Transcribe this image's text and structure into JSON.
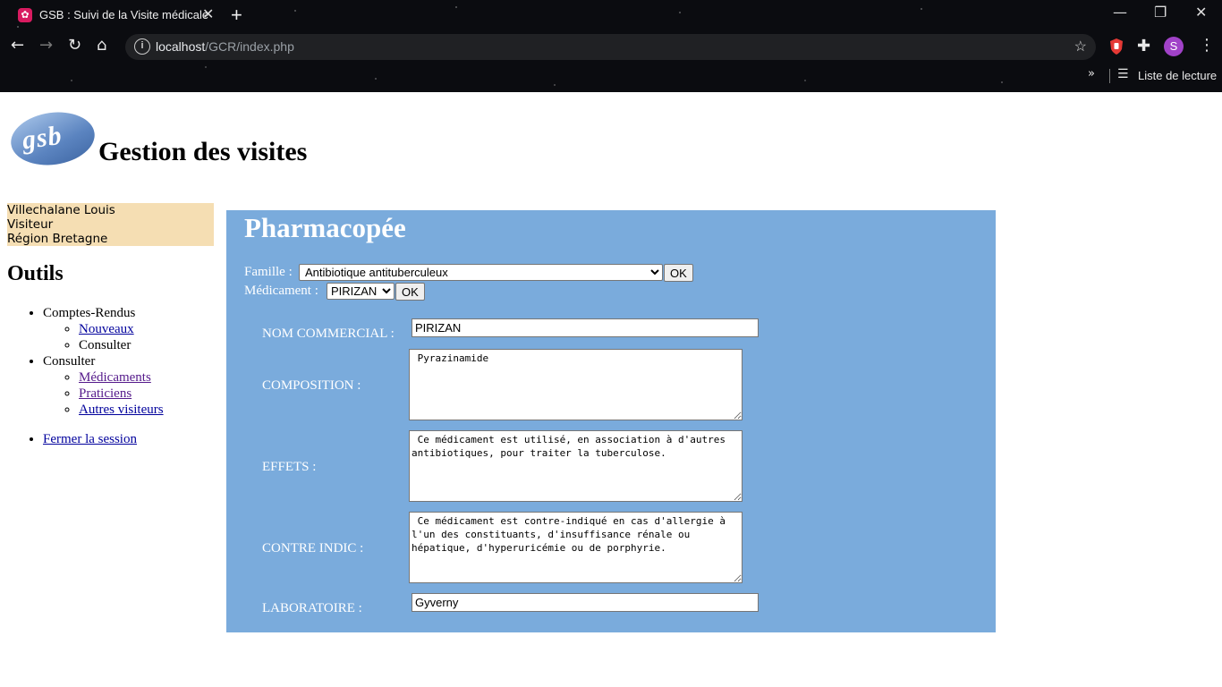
{
  "browser": {
    "tab_title": "GSB : Suivi de la Visite médicale",
    "url_host": "localhost",
    "url_path": "/GCR/index.php",
    "reading_list": "Liste de lecture",
    "profile_initial": "S"
  },
  "header": {
    "logo_text": "gsb",
    "title": "Gestion des visites"
  },
  "user": {
    "name": "Villechalane Louis",
    "role": "Visiteur",
    "region": "Région Bretagne"
  },
  "sidebar": {
    "heading": "Outils",
    "comptes_rendus": "Comptes-Rendus",
    "nouveaux": "Nouveaux",
    "consulter_cr": "Consulter",
    "consulter": "Consulter",
    "medicaments": "Médicaments",
    "praticiens": "Praticiens",
    "autres_visiteurs": "Autres visiteurs",
    "logout": "Fermer la session"
  },
  "pharmacopee": {
    "title": "Pharmacopée",
    "famille_label": "Famille :",
    "famille_selected": "Antibiotique antituberculeux",
    "medicament_label": "Médicament :",
    "medicament_selected": "PIRIZAN",
    "ok_label": "OK",
    "nom_label": "NOM COMMERCIAL :",
    "nom_value": "PIRIZAN",
    "composition_label": "COMPOSITION :",
    "composition_value": " Pyrazinamide",
    "effets_label": "EFFETS :",
    "effets_value": " Ce médicament est utilisé, en association à d'autres antibiotiques, pour traiter la tuberculose.",
    "contre_label": "CONTRE INDIC :",
    "contre_value": " Ce médicament est contre-indiqué en cas d'allergie à  l'un des constituants, d'insuffisance rénale ou hépatique, d'hyperuricémie ou de porphyrie.",
    "labo_label": "LABORATOIRE :",
    "labo_value": "Gyverny"
  }
}
